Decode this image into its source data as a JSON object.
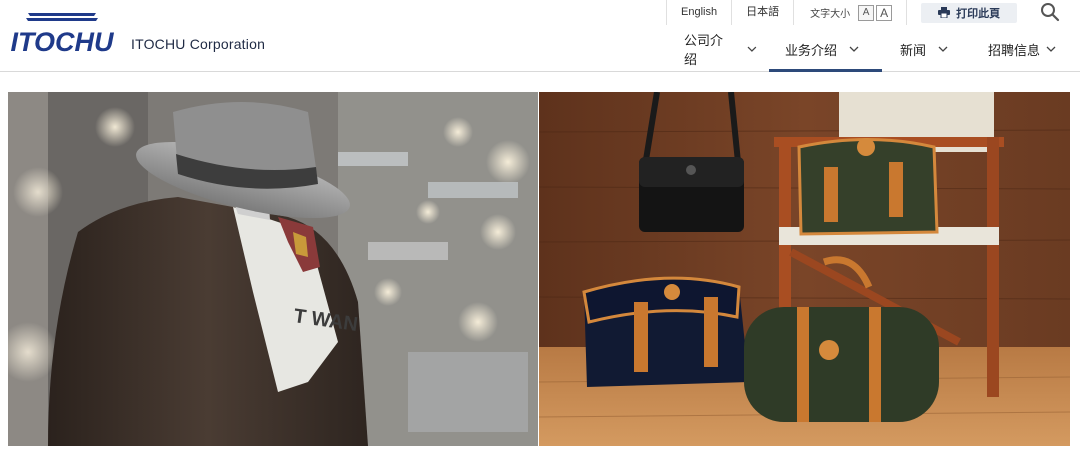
{
  "brand": {
    "logo_text": "ITOCHU",
    "corporation": "ITOCHU Corporation",
    "color": "#1f3a8a"
  },
  "utility": {
    "english": "English",
    "japanese": "日本語",
    "font_size_label": "文字大小",
    "font_small": "A",
    "font_large": "A",
    "print_label": "打印此頁"
  },
  "nav": [
    {
      "label": "公司介绍",
      "active": false
    },
    {
      "label": "业务介绍",
      "active": true
    },
    {
      "label": "新闻",
      "active": false
    },
    {
      "label": "招聘信息",
      "active": false
    }
  ],
  "hero": {
    "left": {
      "overlay_text": "T WAN"
    }
  },
  "colors": {
    "accent": "#2d4a7a",
    "text": "#222222",
    "border": "#d9d9d9"
  }
}
